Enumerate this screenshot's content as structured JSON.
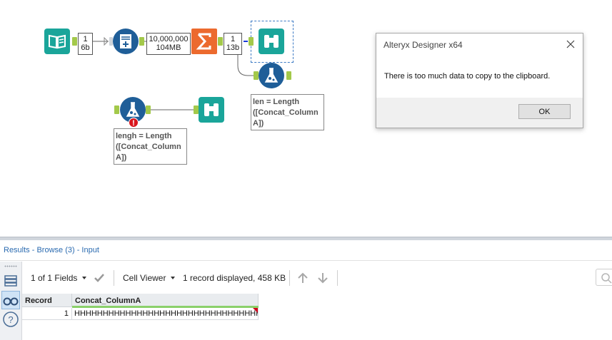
{
  "workflow": {
    "badges": {
      "input_records": "1",
      "input_size": "6b",
      "gen_records": "10,000,000",
      "gen_size": "104MB",
      "summ_records": "1",
      "summ_size": "13b"
    },
    "annotations": {
      "formula_top": [
        "len = Length",
        "([Concat_Column",
        "A])"
      ],
      "formula_bottom": [
        "lengh = Length",
        "([Concat_Column",
        "A])"
      ]
    },
    "error_mark": "!"
  },
  "dialog": {
    "title": "Alteryx Designer x64",
    "message": "There is too much data to copy to the clipboard.",
    "ok_label": "OK"
  },
  "results": {
    "header_title": "Results - Browse (3) - Input",
    "toolbar": {
      "fields_label": "1 of 1 Fields",
      "viewer_label": "Cell Viewer",
      "status": "1 record displayed, 458 KB"
    },
    "columns": [
      "Record",
      "Concat_ColumnA"
    ],
    "rows": [
      {
        "record": "1",
        "value": "HHHHHHHHHHHHHHHHHHHHHHHHHHHHHHHHHHHH..."
      }
    ]
  },
  "colors": {
    "teal": "#1aa59a",
    "navy": "#1f5e98",
    "orange": "#ec6a2e",
    "anchor": "#a3c94a",
    "link": "#2a6ab0"
  }
}
